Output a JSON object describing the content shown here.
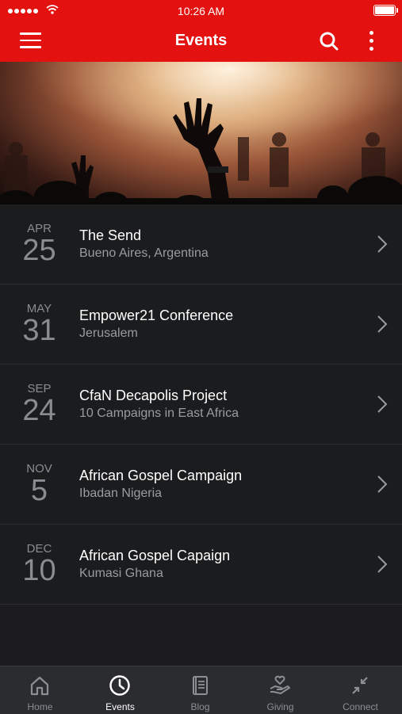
{
  "status_bar": {
    "time": "10:26 AM"
  },
  "nav": {
    "title": "Events",
    "menu_icon": "hamburger-menu-icon",
    "search_icon": "search-icon",
    "more_icon": "more-vertical-icon"
  },
  "hero": {
    "image": "concert crowd with raised hands"
  },
  "events": [
    {
      "month": "APR",
      "day": "25",
      "title": "The Send",
      "location": "Bueno Aires, Argentina"
    },
    {
      "month": "MAY",
      "day": "31",
      "title": "Empower21 Conference",
      "location": "Jerusalem"
    },
    {
      "month": "SEP",
      "day": "24",
      "title": "CfaN Decapolis Project",
      "location": "10 Campaigns in East Africa"
    },
    {
      "month": "NOV",
      "day": "5",
      "title": "African Gospel Campaign",
      "location": "Ibadan Nigeria"
    },
    {
      "month": "DEC",
      "day": "10",
      "title": "African Gospel Capaign",
      "location": "Kumasi Ghana"
    }
  ],
  "tabs": [
    {
      "label": "Home",
      "icon": "home-icon"
    },
    {
      "label": "Events",
      "icon": "clock-icon",
      "active": true
    },
    {
      "label": "Blog",
      "icon": "book-icon"
    },
    {
      "label": "Giving",
      "icon": "giving-hand-icon"
    },
    {
      "label": "Connect",
      "icon": "connect-arrows-icon"
    }
  ],
  "colors": {
    "accent": "#e3110f",
    "background": "#1b1c1e",
    "tabbar": "#2b2c30"
  }
}
